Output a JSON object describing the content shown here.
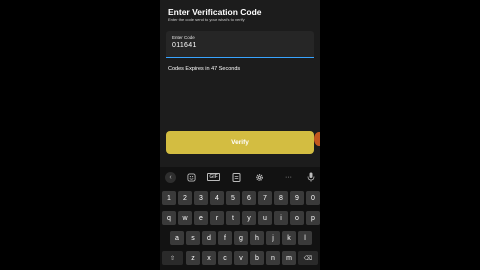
{
  "screen": {
    "title": "Enter Verification Code",
    "subtitle": "Enter the code send to your what's to verify",
    "code_field": {
      "label": "Enter Code",
      "value": "011641"
    },
    "expiry_text": "Codes Expires in 47 Seconds",
    "verify_label": "Verify"
  },
  "keyboard": {
    "toolbar": {
      "back": "‹",
      "gif": "GIF",
      "more": "···"
    },
    "rows": [
      [
        "1",
        "2",
        "3",
        "4",
        "5",
        "6",
        "7",
        "8",
        "9",
        "0"
      ],
      [
        "q",
        "w",
        "e",
        "r",
        "t",
        "y",
        "u",
        "i",
        "o",
        "p"
      ],
      [
        "a",
        "s",
        "d",
        "f",
        "g",
        "h",
        "j",
        "k",
        "l"
      ],
      [
        "⇧",
        "z",
        "x",
        "c",
        "v",
        "b",
        "n",
        "m",
        "⌫"
      ]
    ]
  },
  "colors": {
    "accent_underline": "#38a4ff",
    "verify_button": "#d3bd41",
    "background": "#1c1c1c"
  }
}
